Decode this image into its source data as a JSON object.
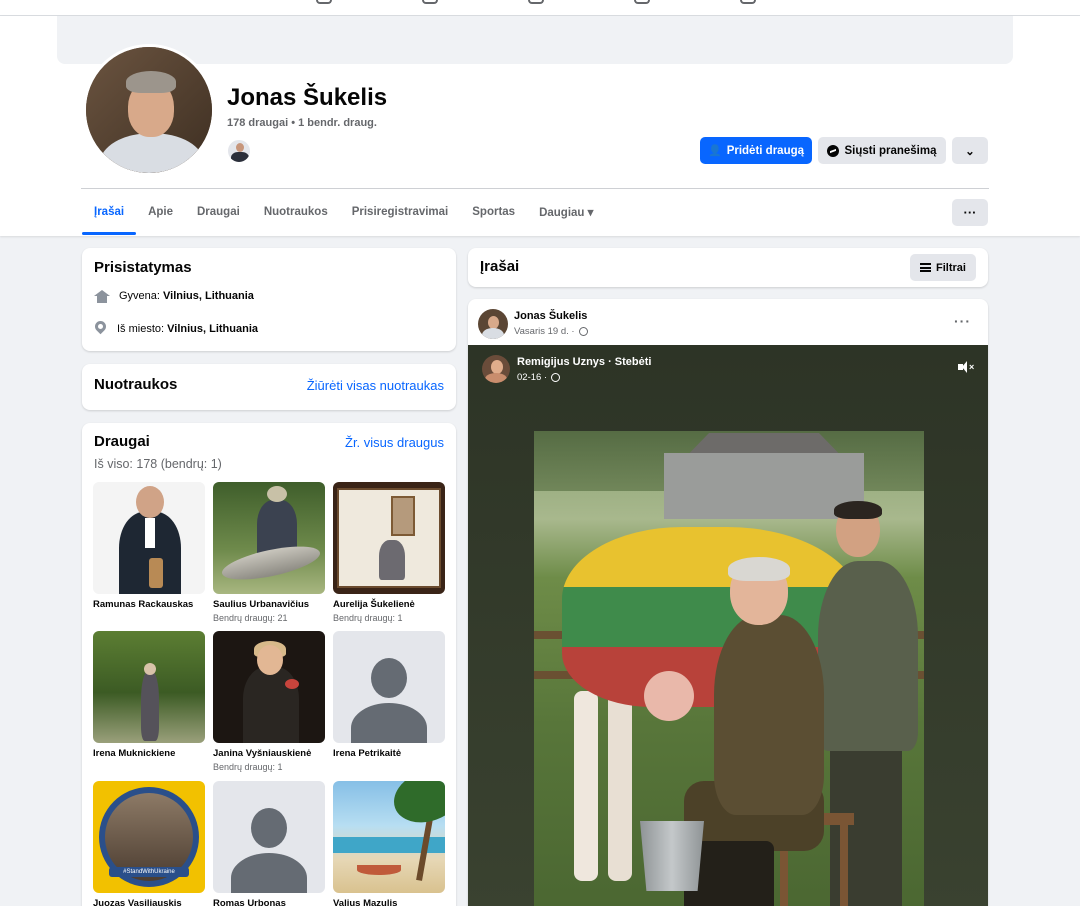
{
  "profile": {
    "name": "Jonas Šukelis",
    "friend_count": "178 draugai • 1 bendr. draug.",
    "add_friend_label": "Pridėti draugą",
    "message_label": "Siųsti pranešimą"
  },
  "tabs": [
    {
      "label": "Įrašai",
      "active": true
    },
    {
      "label": "Apie"
    },
    {
      "label": "Draugai"
    },
    {
      "label": "Nuotraukos"
    },
    {
      "label": "Prisiregistravimai"
    },
    {
      "label": "Sportas"
    },
    {
      "label": "Daugiau ▾"
    }
  ],
  "intro": {
    "title": "Prisistatymas",
    "lives_prefix": "Gyvena:",
    "lives_value": "Vilnius, Lithuania",
    "from_prefix": "Iš miesto:",
    "from_value": "Vilnius, Lithuania"
  },
  "photos": {
    "title": "Nuotraukos",
    "see_all": "Žiūrėti visas nuotraukas"
  },
  "friends": {
    "title": "Draugai",
    "see_all": "Žr. visus draugus",
    "subtitle": "Iš viso: 178 (bendrų: 1)",
    "items": [
      {
        "name": "Ramunas Rackauskas",
        "mutual": ""
      },
      {
        "name": "Saulius Urbanavičius",
        "mutual": "Bendrų draugų: 21"
      },
      {
        "name": "Aurelija Šukelienė",
        "mutual": "Bendrų draugų: 1"
      },
      {
        "name": "Irena Muknickiene",
        "mutual": ""
      },
      {
        "name": "Janina Vyšniauskienė",
        "mutual": "Bendrų draugų: 1"
      },
      {
        "name": "Irena Petrikaitė",
        "mutual": ""
      },
      {
        "name": "Juozas Vasiliauskis",
        "mutual": ""
      },
      {
        "name": "Romas Urbonas",
        "mutual": ""
      },
      {
        "name": "Valius Mazulis",
        "mutual": ""
      }
    ],
    "badge_text": "#StandWithUkraine"
  },
  "posts": {
    "title": "Įrašai",
    "filter_label": "Filtrai"
  },
  "post": {
    "author": "Jonas Šukelis",
    "date": "Vasaris 19 d. ·",
    "more": "···",
    "shared_author": "Remigijus Uznys · Stebėti",
    "shared_date": "02-16 ·"
  },
  "colors": {
    "accent": "#0866ff",
    "secondary_button": "#e4e6eb",
    "page_bg": "#f0f2f5"
  },
  "icons": [
    "add-friend-icon",
    "messenger-icon",
    "chevron-down-icon",
    "more-icon",
    "home-icon",
    "location-pin-icon",
    "filter-icon",
    "globe-icon",
    "mute-icon"
  ]
}
